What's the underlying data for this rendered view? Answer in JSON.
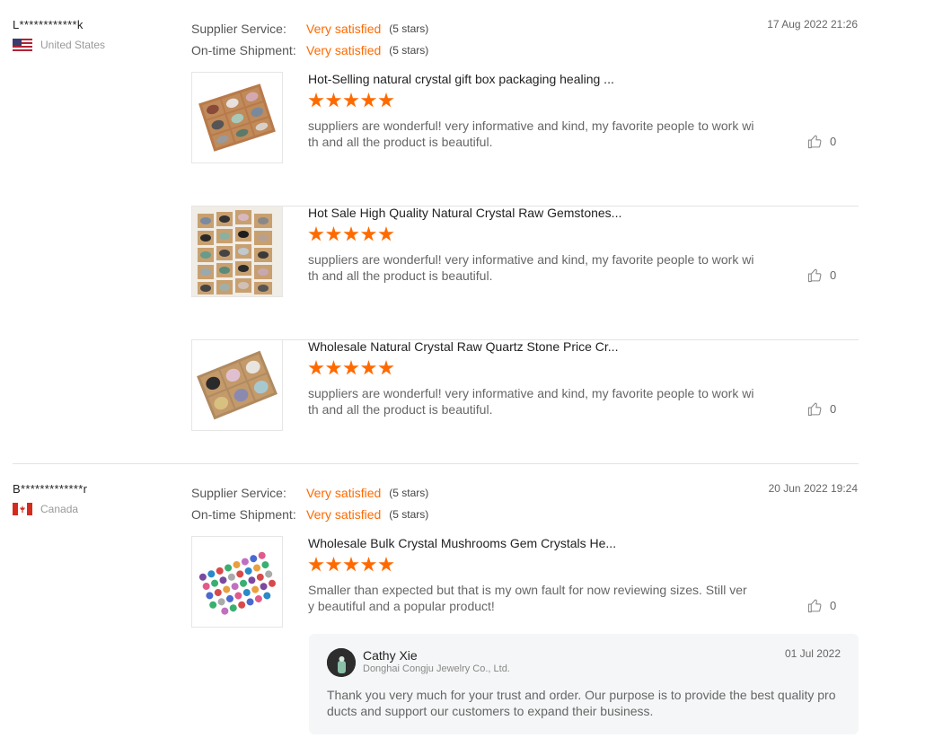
{
  "reviews": [
    {
      "buyer": "L************k",
      "country": "United States",
      "date": "17 Aug 2022 21:26",
      "ratings": [
        {
          "label": "Supplier Service:",
          "value": "Very satisfied",
          "stars": "(5 stars)"
        },
        {
          "label": "On-time Shipment:",
          "value": "Very satisfied",
          "stars": "(5 stars)"
        }
      ],
      "products": [
        {
          "title": "Hot-Selling natural crystal gift box packaging healing ...",
          "stars": 5,
          "comment": "suppliers are wonderful! very informative and kind, my favorite people to work with and all the product is beautiful.",
          "likes": "0"
        },
        {
          "title": "Hot Sale High Quality Natural Crystal Raw Gemstones...",
          "stars": 5,
          "comment": "suppliers are wonderful! very informative and kind, my favorite people to work with and all the product is beautiful.",
          "likes": "0"
        },
        {
          "title": "Wholesale Natural Crystal Raw Quartz Stone Price Cr...",
          "stars": 5,
          "comment": "suppliers are wonderful! very informative and kind, my favorite people to work with and all the product is beautiful.",
          "likes": "0"
        }
      ]
    },
    {
      "buyer": "B*************r",
      "country": "Canada",
      "date": "20 Jun 2022 19:24",
      "ratings": [
        {
          "label": "Supplier Service:",
          "value": "Very satisfied",
          "stars": "(5 stars)"
        },
        {
          "label": "On-time Shipment:",
          "value": "Very satisfied",
          "stars": "(5 stars)"
        }
      ],
      "products": [
        {
          "title": "Wholesale Bulk Crystal Mushrooms Gem Crystals He...",
          "stars": 5,
          "comment": "Smaller than expected but that is my own fault for now reviewing sizes. Still very beautiful and a popular product!",
          "likes": "0"
        }
      ],
      "reply": {
        "name": "Cathy Xie",
        "company": "Donghai Congju Jewelry Co., Ltd.",
        "date": "01 Jul 2022",
        "text": "Thank you very much for your trust and order. Our purpose is to provide the best quality products and support our customers to expand their business."
      }
    }
  ],
  "colors": {
    "accent": "#ff6a00",
    "divider": "#e3e3e3",
    "reply_bg": "#f5f6f7"
  },
  "icons": [
    "thumbs-up-icon",
    "star-icon",
    "us-flag-icon",
    "canada-flag-icon"
  ]
}
